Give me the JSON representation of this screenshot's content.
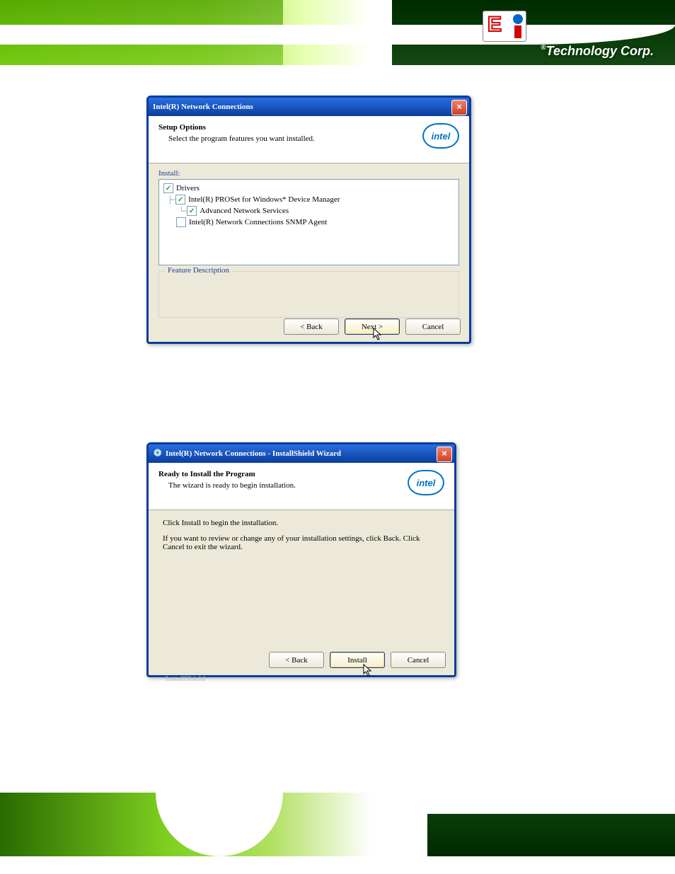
{
  "brand": {
    "name": "Technology Corp.",
    "reg": "®"
  },
  "dialog1": {
    "title": "Intel(R) Network Connections",
    "header": "Setup Options",
    "subheader": "Select the program features you want installed.",
    "logo_text": "intel",
    "install_label": "Install:",
    "tree": {
      "n1": "Drivers",
      "n2": "Intel(R) PROSet for Windows* Device Manager",
      "n3": "Advanced Network Services",
      "n4": "Intel(R) Network Connections SNMP Agent"
    },
    "feature_desc_label": "Feature Description",
    "buttons": {
      "back": "< Back",
      "next": "Next >",
      "cancel": "Cancel"
    }
  },
  "dialog2": {
    "title": "Intel(R) Network Connections - InstallShield Wizard",
    "header": "Ready to Install the Program",
    "subheader": "The wizard is ready to begin installation.",
    "logo_text": "intel",
    "body1": "Click Install to begin the installation.",
    "body2": "If you want to review or change any of your installation settings, click Back. Click Cancel to exit the wizard.",
    "installshield": "InstallShield",
    "buttons": {
      "back": "< Back",
      "install": "Install",
      "cancel": "Cancel"
    }
  }
}
